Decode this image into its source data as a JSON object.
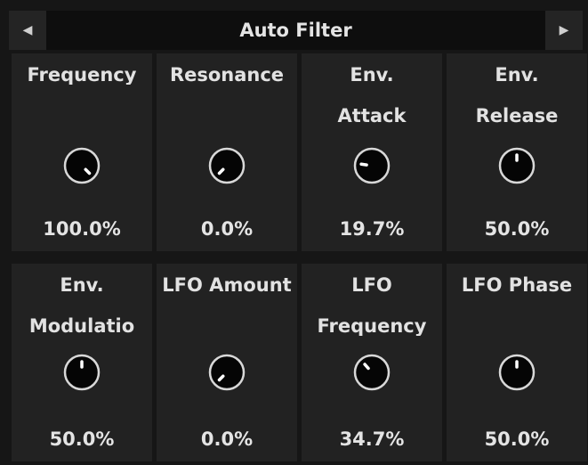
{
  "device": {
    "title": "Auto Filter",
    "prev_icon": "triangle-left-icon",
    "next_icon": "triangle-right-icon"
  },
  "params": [
    {
      "line1": "Frequency",
      "line2": "",
      "value_text": "100.0%",
      "level": 1.0
    },
    {
      "line1": "Resonance",
      "line2": "",
      "value_text": "0.0%",
      "level": 0.0
    },
    {
      "line1": "Env.",
      "line2": "Attack",
      "value_text": "19.7%",
      "level": 0.197
    },
    {
      "line1": "Env.",
      "line2": "Release",
      "value_text": "50.0%",
      "level": 0.5
    },
    {
      "line1": "Env.",
      "line2": "Modulatio",
      "value_text": "50.0%",
      "level": 0.5
    },
    {
      "line1": "LFO Amount",
      "line2": "",
      "value_text": "0.0%",
      "level": 0.0
    },
    {
      "line1": "LFO",
      "line2": "Frequency",
      "value_text": "34.7%",
      "level": 0.347
    },
    {
      "line1": "LFO Phase",
      "line2": "",
      "value_text": "50.0%",
      "level": 0.5
    }
  ],
  "colors": {
    "background": "#161616",
    "panel": "#222222",
    "knob_fill": "#050505",
    "knob_ring": "#d8d8d8",
    "pointer": "#ffffff"
  }
}
